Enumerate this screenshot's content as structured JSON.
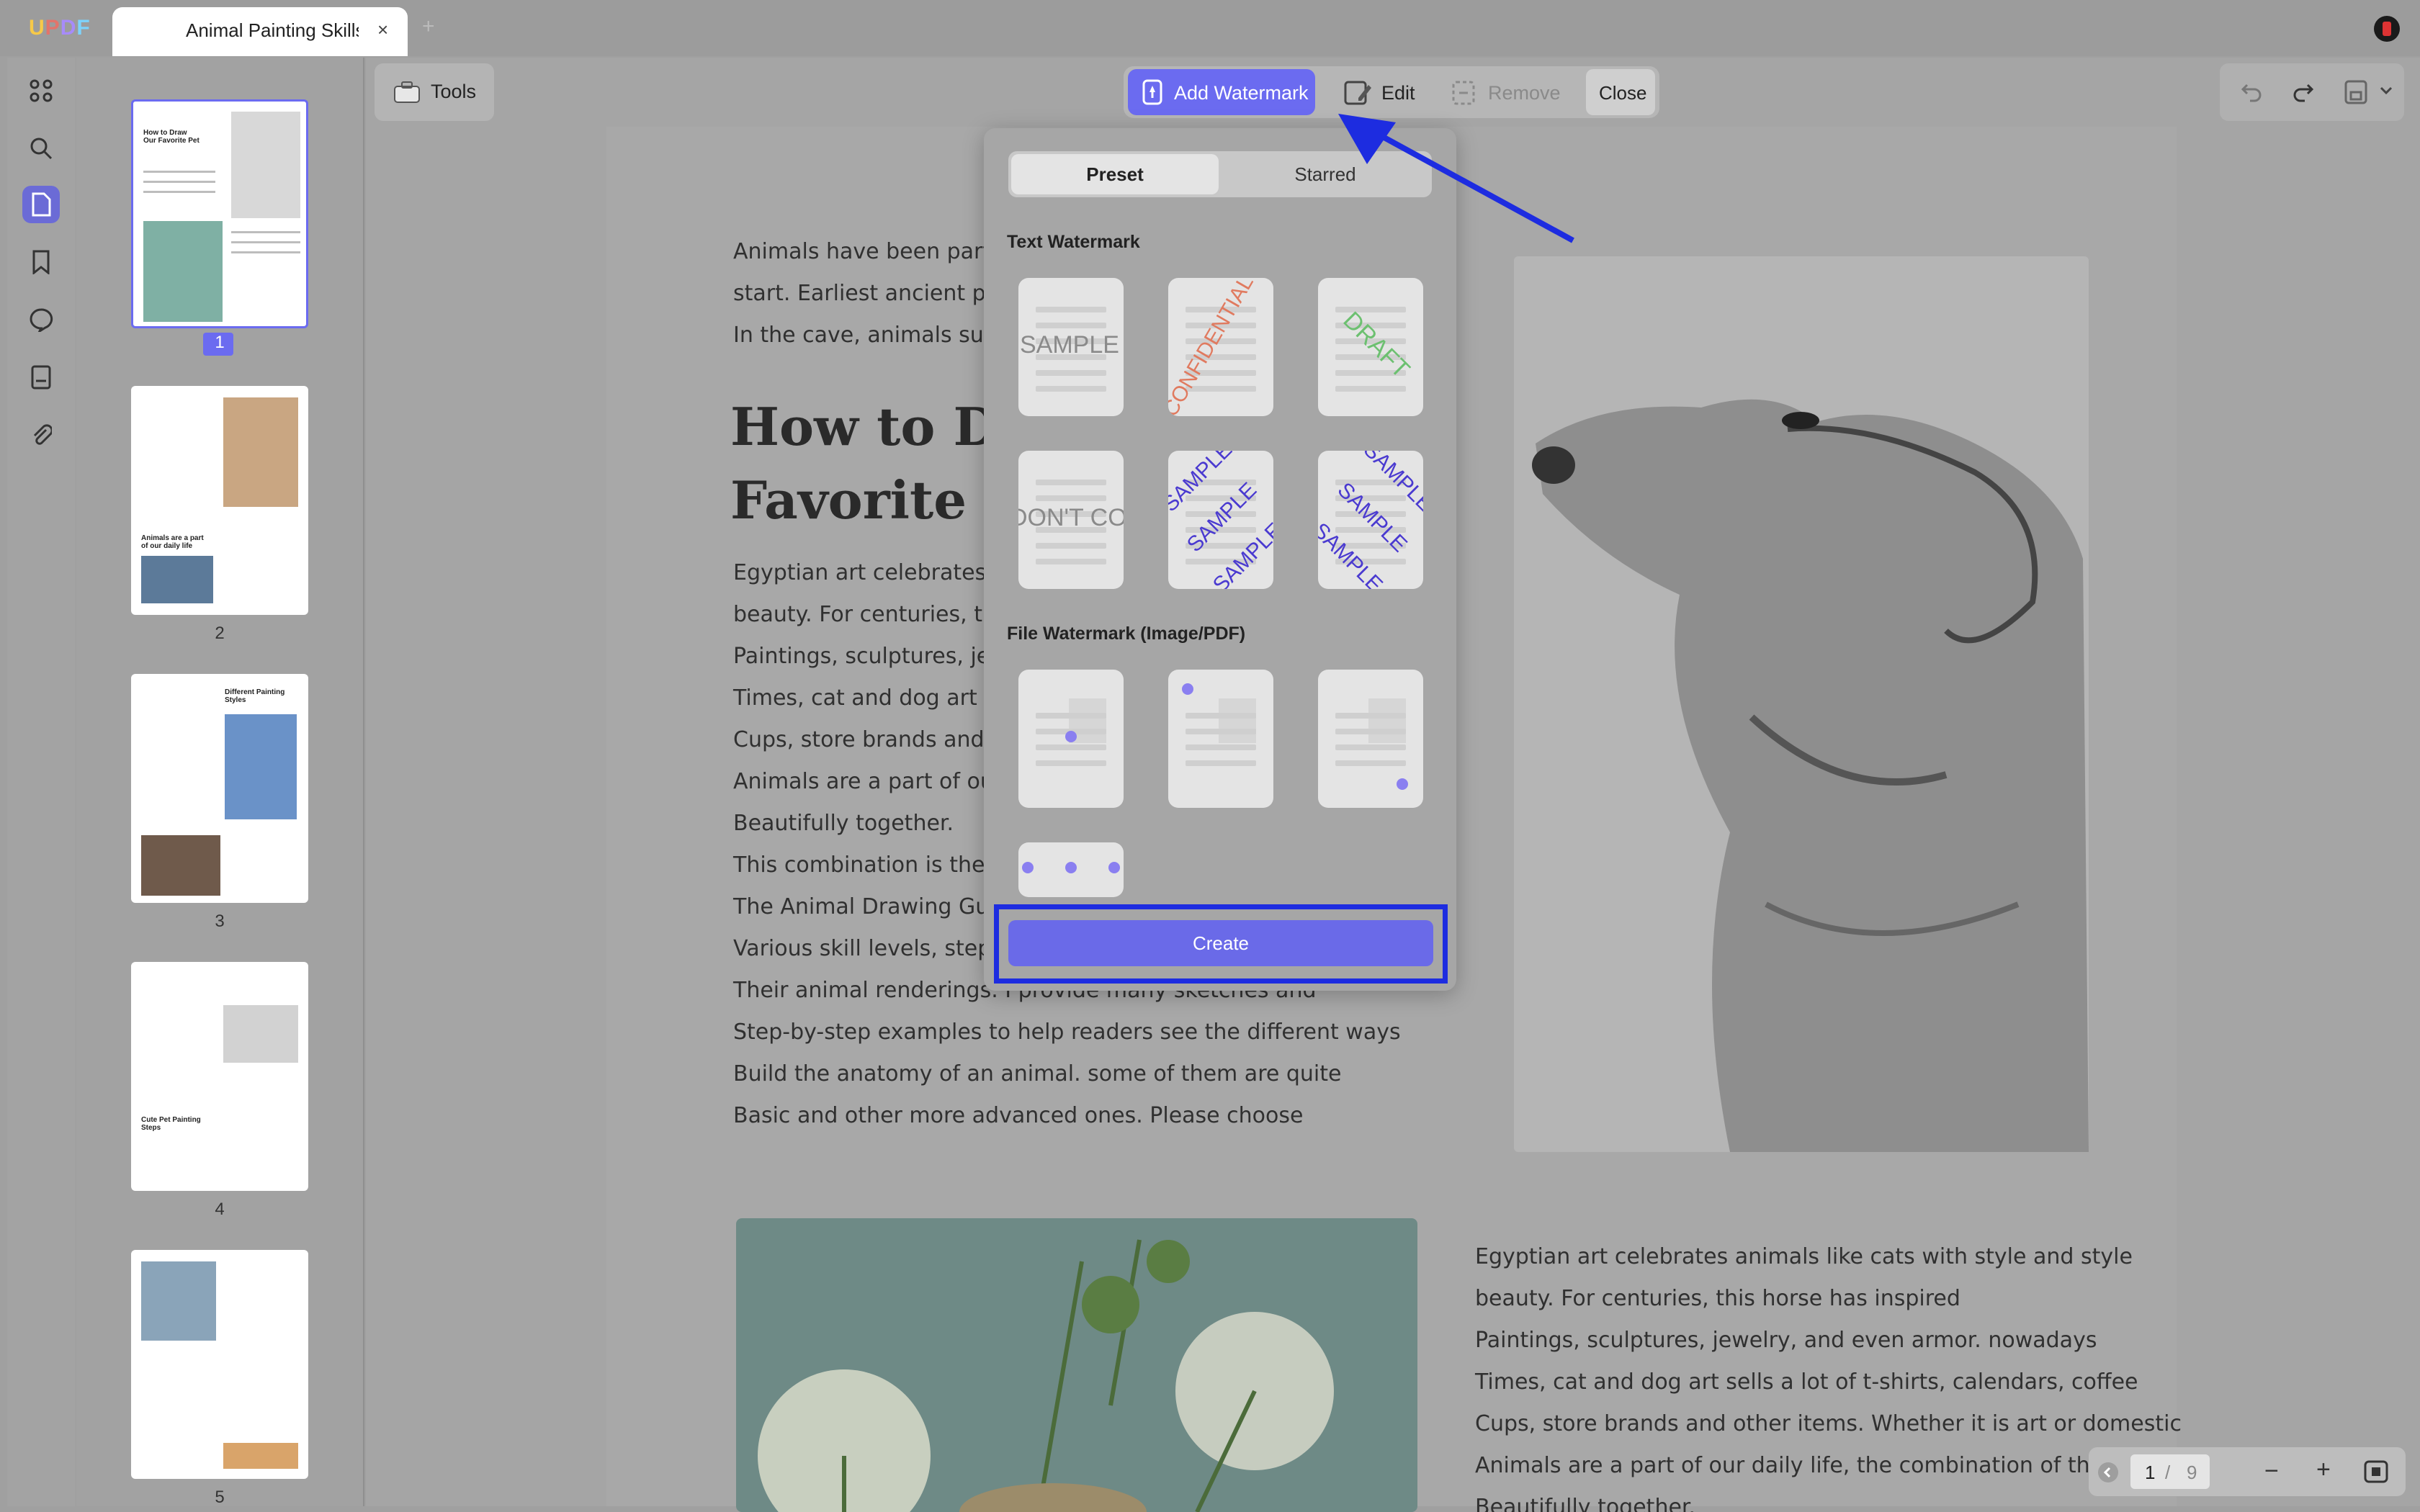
{
  "app": {
    "logo": "UPDF",
    "tab_title": "Animal Painting Skills",
    "tab_close": "×",
    "tab_add": "+"
  },
  "rail": {
    "icons": [
      "grid-icon",
      "search-icon",
      "pages-icon",
      "bookmark-icon",
      "comment-icon",
      "file-icon",
      "attachment-icon"
    ]
  },
  "thumbnails": [
    {
      "number": "1",
      "heading": "How to Draw Our Favorite Pet"
    },
    {
      "number": "2",
      "heading": "Animals are a part of our daily life"
    },
    {
      "number": "3",
      "heading": "Different Painting Styles"
    },
    {
      "number": "4",
      "heading": "Cute Pet Painting Steps"
    },
    {
      "number": "5",
      "heading": ""
    }
  ],
  "toolbar": {
    "tools_label": "Tools",
    "add_watermark_label": "Add Watermark",
    "edit_label": "Edit",
    "remove_label": "Remove",
    "close_label": "Close"
  },
  "popup": {
    "tab_preset": "Preset",
    "tab_starred": "Starred",
    "text_section": "Text Watermark",
    "file_section": "File Watermark (Image/PDF)",
    "create_label": "Create",
    "text_presets": [
      "SAMPLE",
      "CONFIDENTIAL",
      "DRAFT",
      "DON'T COPY",
      "SAMPLE",
      "SAMPLE"
    ]
  },
  "document": {
    "intro_lines": [
      "Animals have been part o",
      "start. Earliest ancient pai",
      "In the cave, animals such"
    ],
    "heading_lines": [
      "How to Dr",
      "Favorite P"
    ],
    "body_left": [
      "Egyptian art celebrates a",
      "beauty. For centuries, thi",
      "Paintings, sculptures, jew",
      "Times, cat and dog art se",
      "Cups, store brands and ot",
      "Animals are a part of our",
      "Beautifully together.",
      "This combination is the s",
      "The Animal Drawing Guide",
      "Various skill levels, stepp",
      "Their animal renderings. I provide many sketches and",
      "Step-by-step examples to help readers see the different ways",
      "Build the anatomy of an animal. some of them are quite",
      "Basic and other more advanced ones. Please choose"
    ],
    "body_right": [
      "Egyptian art celebrates animals like cats with style and style",
      "beauty. For centuries, this horse has inspired",
      "Paintings, sculptures, jewelry, and even armor. nowadays",
      "Times, cat and dog art sells a lot of t-shirts, calendars, coffee",
      "Cups, store brands and other items. Whether it is art or domestic",
      "Animals are a part of our daily life, the combination of the two",
      "Beautifully together."
    ]
  },
  "pager": {
    "current": "1",
    "separator": "/",
    "total": "9",
    "zoom_out": "−",
    "zoom_in": "+"
  },
  "colors": {
    "accent": "#6b6bf0",
    "annotation": "#1d2ce0"
  }
}
